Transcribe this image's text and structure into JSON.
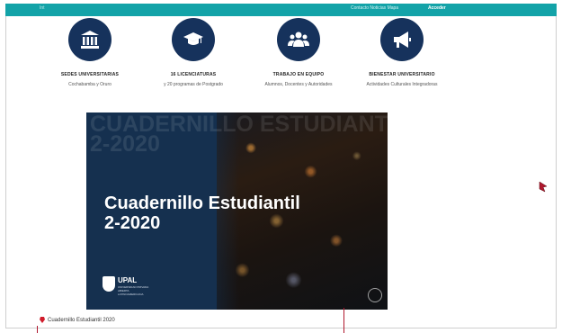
{
  "topbar": {
    "left_text": "Int",
    "mid_text": "Contacto  Noticias  Mapa",
    "right_text": "Acceder"
  },
  "features": [
    {
      "icon": "institution-icon",
      "title": "SEDES UNIVERSITARIAS",
      "subtitle": "Cochabamba y Oruro"
    },
    {
      "icon": "graduation-cap-icon",
      "title": "16 LICENCIATURAS",
      "subtitle": "y 20 programas de Postgrado"
    },
    {
      "icon": "team-icon",
      "title": "TRABAJO EN EQUIPO",
      "subtitle": "Alumnos, Docentes y Autoridades"
    },
    {
      "icon": "megaphone-icon",
      "title": "BIENESTAR UNIVERSITARIO",
      "subtitle": "Actividades Culturales Integradoras"
    }
  ],
  "banner": {
    "ghost_line1": "CUADERNILLO ESTUDIANTIL",
    "ghost_line2": "2-2020",
    "title_line1": "Cuadernillo Estudiantil",
    "title_line2": "2-2020",
    "logo_name": "UPAL",
    "logo_tag": "UNIVERSIDAD PRIVADA ABIERTA LATINOAMERICANA"
  },
  "caption": {
    "text": "Cuadernillo Estudiantil 2020"
  },
  "colors": {
    "accent": "#13a3a8",
    "icon_bg": "#16325c",
    "banner_bg": "#15304f",
    "marker": "#b0182e"
  }
}
